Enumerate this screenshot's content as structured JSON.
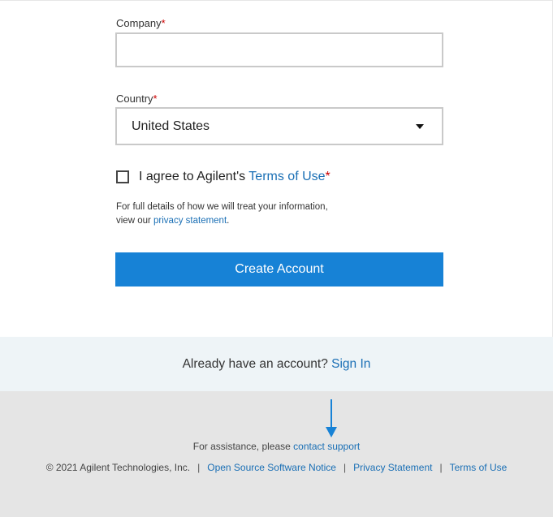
{
  "form": {
    "company": {
      "label": "Company",
      "required_mark": "*",
      "value": ""
    },
    "country": {
      "label": "Country",
      "required_mark": "*",
      "selected": "United States"
    },
    "agree": {
      "prefix": "I agree to Agilent's ",
      "terms_link": "Terms of Use",
      "required_mark": "*",
      "checked": false
    },
    "details": {
      "line1": "For full details of how we will treat your information,",
      "line2_prefix": "view our ",
      "privacy_link": "privacy statement",
      "line2_suffix": "."
    },
    "submit_label": "Create Account"
  },
  "signin": {
    "prompt": "Already have an account?",
    "link": "Sign In"
  },
  "footer": {
    "assist_prefix": "For assistance, please ",
    "contact_link": "contact support",
    "copyright": "© 2021 Agilent Technologies, Inc.",
    "separator": "|",
    "links": [
      "Open Source Software Notice",
      "Privacy Statement",
      "Terms of Use"
    ]
  },
  "colors": {
    "accent": "#1782d6",
    "link": "#1a6fb5",
    "required": "#cc0000",
    "signin_bg": "#eef4f7",
    "footer_bg": "#e5e5e5"
  },
  "icons": {
    "dropdown": "caret-down-icon",
    "annotation": "arrow-down-icon"
  }
}
